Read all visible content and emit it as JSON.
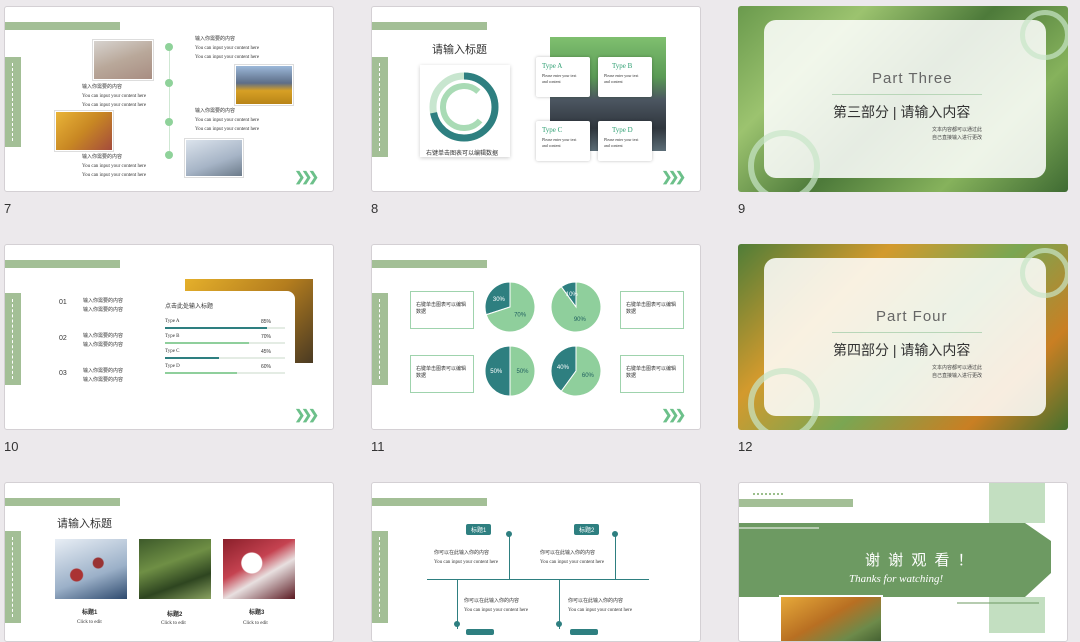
{
  "slides": [
    {
      "number": "7",
      "lines": {
        "t1": "输入你需要的内容",
        "en": "You can input your content here"
      },
      "color": "#a3bf96"
    },
    {
      "number": "8",
      "title": "请输入标题",
      "caption": "右键单击图表可以编辑数据",
      "types": [
        "Type A",
        "Type B",
        "Type C",
        "Type D"
      ],
      "type_desc": "Please enter your text and content"
    },
    {
      "number": "9",
      "part": "Part Three",
      "heading": "第三部分 | 请输入内容",
      "note": [
        "文本内容都可以通过此",
        "自己直接输入进行更改"
      ]
    },
    {
      "number": "10",
      "items": [
        "01",
        "02",
        "03"
      ],
      "item_text": "输入你需要的内容",
      "panel_title": "点击此处输入标题",
      "bars": [
        {
          "label": "Type A",
          "pct": "85%",
          "value": 0.85
        },
        {
          "label": "Type B",
          "pct": "70%",
          "value": 0.7
        },
        {
          "label": "Type C",
          "pct": "45%",
          "value": 0.45
        },
        {
          "label": "Type D",
          "pct": "60%",
          "value": 0.6
        }
      ]
    },
    {
      "number": "11",
      "box_text": "右键单击图表可以编辑数据",
      "pies": [
        {
          "a": "30%",
          "b": "70%",
          "av": 0.3
        },
        {
          "a": "10%",
          "b": "90%",
          "av": 0.1
        },
        {
          "a": "50%",
          "b": "50%",
          "av": 0.5
        },
        {
          "a": "40%",
          "b": "60%",
          "av": 0.4
        }
      ]
    },
    {
      "number": "12",
      "part": "Part Four",
      "heading": "第四部分 | 请输入内容",
      "note": [
        "文本内容都可以通过此",
        "自己直接输入进行更改"
      ]
    },
    {
      "number": "",
      "title": "请输入标题",
      "captions": [
        {
          "title": "标题1",
          "sub": "Click to edit"
        },
        {
          "title": "标题2",
          "sub": "Click to edit"
        },
        {
          "title": "标题3",
          "sub": "Click to edit"
        }
      ]
    },
    {
      "number": "",
      "tags": [
        "标题1",
        "标题2"
      ],
      "cn": "你可以在此输入你的内容",
      "en": "You can input your content here"
    },
    {
      "number": "",
      "thanks_cn": "谢 谢 观 看 ！",
      "thanks_en": "Thanks  for  watching!"
    }
  ]
}
